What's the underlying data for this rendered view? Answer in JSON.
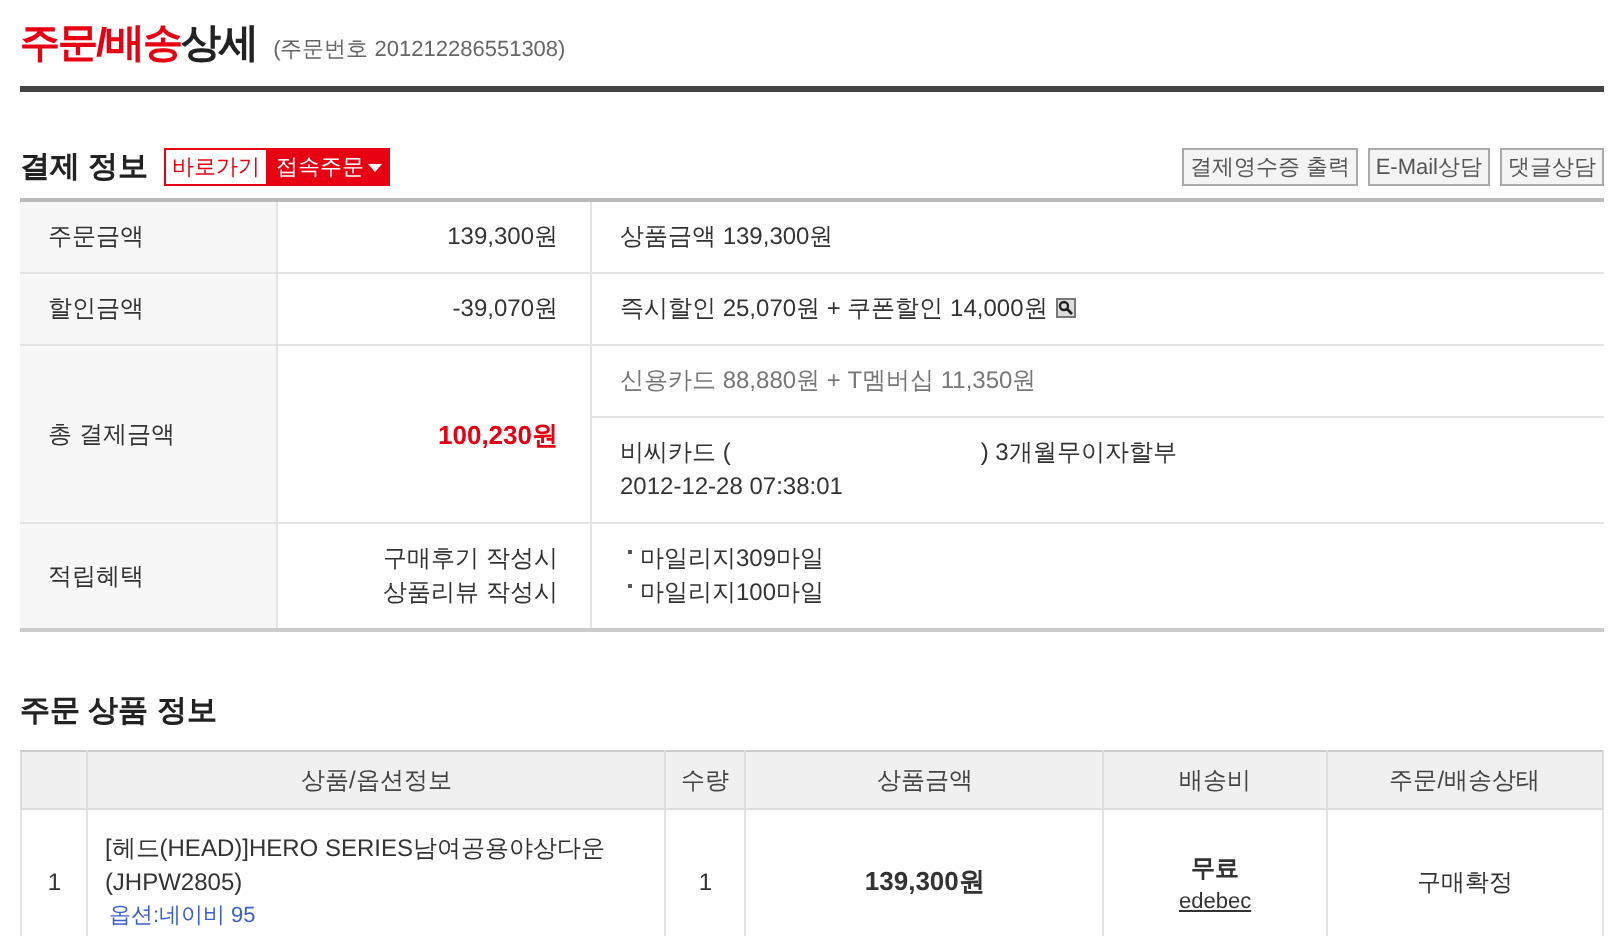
{
  "title": {
    "highlight": "주문/배송",
    "rest": "상세",
    "order_number": "(주문번호 201212286551308)"
  },
  "payment": {
    "heading": "결제 정보",
    "shortcut": "바로가기",
    "shortcut_menu": "접속주문",
    "buttons": [
      "결제영수증 출력",
      "E-Mail상담",
      "댓글상담"
    ],
    "rows": [
      {
        "label": "주문금액",
        "amounts": [
          "139,300원"
        ],
        "emphasis": false,
        "cells": [
          {
            "kind": "text",
            "lines": [
              "상품금액 139,300원"
            ]
          }
        ]
      },
      {
        "label": "할인금액",
        "amounts": [
          "-39,070원"
        ],
        "emphasis": false,
        "cells": [
          {
            "kind": "text_zoom",
            "lines": [
              "즉시할인 25,070원 + 쿠폰할인 14,000원"
            ]
          }
        ]
      },
      {
        "label": "총 결제금액",
        "amounts": [
          "100,230원"
        ],
        "emphasis": true,
        "cells": [
          {
            "kind": "muted",
            "lines": [
              "신용카드 88,880원 + T멤버십 11,350원"
            ]
          },
          {
            "kind": "card",
            "card_open": "비씨카드 (",
            "card_close": ") 3개월무이자할부",
            "time": "2012-12-28 07:38:01"
          }
        ]
      },
      {
        "label": "적립혜택",
        "amounts": [
          "구매후기 작성시",
          "상품리뷰 작성시"
        ],
        "emphasis": false,
        "cells": [
          {
            "kind": "bullets",
            "lines": [
              "마일리지309마일",
              "마일리지100마일"
            ]
          }
        ]
      }
    ]
  },
  "order": {
    "heading": "주문 상품 정보",
    "columns": [
      "상품/옵션정보",
      "수량",
      "상품금액",
      "배송비",
      "주문/배송상태"
    ],
    "rows": [
      {
        "no": "1",
        "product": "[헤드(HEAD)]HERO SERIES남여공용야상다운(JHPW2805)",
        "option": "옵션:네이비 95",
        "qty": "1",
        "price": "139,300원",
        "shipping": "무료",
        "shipping_link": "edebec",
        "status": "구매확정"
      }
    ]
  }
}
